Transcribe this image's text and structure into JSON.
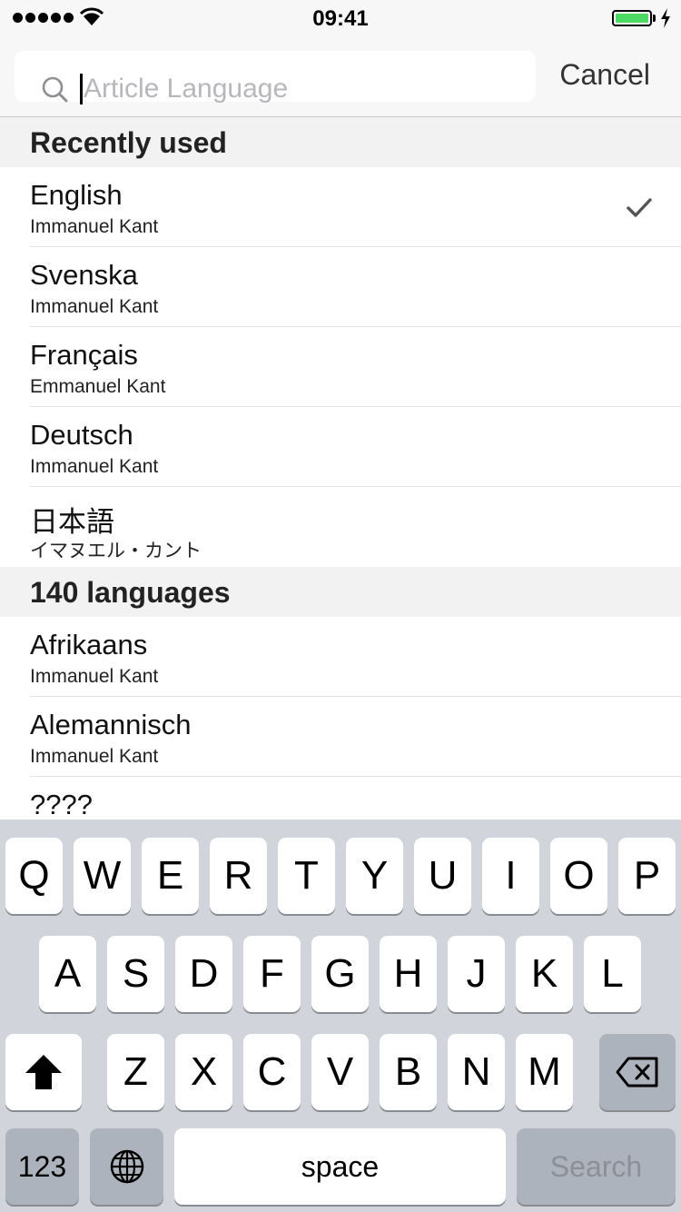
{
  "status_bar": {
    "time": "09:41",
    "battery_color": "#4cd964"
  },
  "search": {
    "placeholder": "Article Language",
    "value": "",
    "cancel_label": "Cancel"
  },
  "sections": [
    {
      "title": "Recently used",
      "items": [
        {
          "name": "English",
          "sub": "Immanuel Kant",
          "selected": true
        },
        {
          "name": "Svenska",
          "sub": "Immanuel Kant"
        },
        {
          "name": "Français",
          "sub": "Emmanuel Kant"
        },
        {
          "name": "Deutsch",
          "sub": "Immanuel Kant"
        },
        {
          "name": "日本語",
          "sub": "イマヌエル・カント"
        }
      ]
    },
    {
      "title": "140 languages",
      "items": [
        {
          "name": "Afrikaans",
          "sub": "Immanuel Kant"
        },
        {
          "name": "Alemannisch",
          "sub": "Immanuel Kant"
        },
        {
          "name": "????",
          "sub": ""
        }
      ]
    }
  ],
  "icons": {
    "search": "search-icon",
    "check": "checkmark-icon",
    "shift": "shift-icon",
    "delete": "delete-icon",
    "globe": "globe-icon"
  },
  "keyboard": {
    "row1": [
      "Q",
      "W",
      "E",
      "R",
      "T",
      "Y",
      "U",
      "I",
      "O",
      "P"
    ],
    "row2": [
      "A",
      "S",
      "D",
      "F",
      "G",
      "H",
      "J",
      "K",
      "L"
    ],
    "row3": [
      "Z",
      "X",
      "C",
      "V",
      "B",
      "N",
      "M"
    ],
    "numbers_label": "123",
    "space_label": "space",
    "search_label": "Search"
  }
}
